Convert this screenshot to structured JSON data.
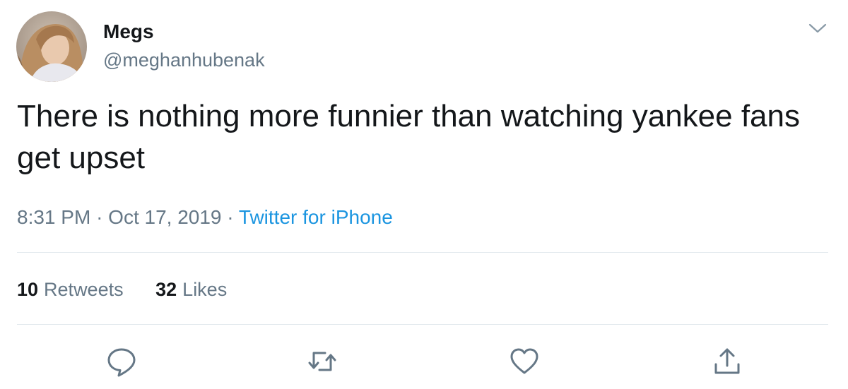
{
  "tweet": {
    "display_name": "Megs",
    "handle": "@meghanhubenak",
    "text": "There is nothing more funnier than watching yankee fans get upset",
    "time": "8:31 PM",
    "separator": "·",
    "date": "Oct 17, 2019",
    "source": "Twitter for iPhone",
    "retweets": {
      "count": "10",
      "label": "Retweets"
    },
    "likes": {
      "count": "32",
      "label": "Likes"
    }
  },
  "icons": {
    "more": "chevron-down-icon",
    "reply": "reply-icon",
    "retweet": "retweet-icon",
    "like": "heart-icon",
    "share": "share-icon"
  },
  "colors": {
    "text": "#14171a",
    "secondary": "#657786",
    "link": "#1b95e0",
    "divider": "#e1e8ed",
    "icon": "#657786"
  }
}
